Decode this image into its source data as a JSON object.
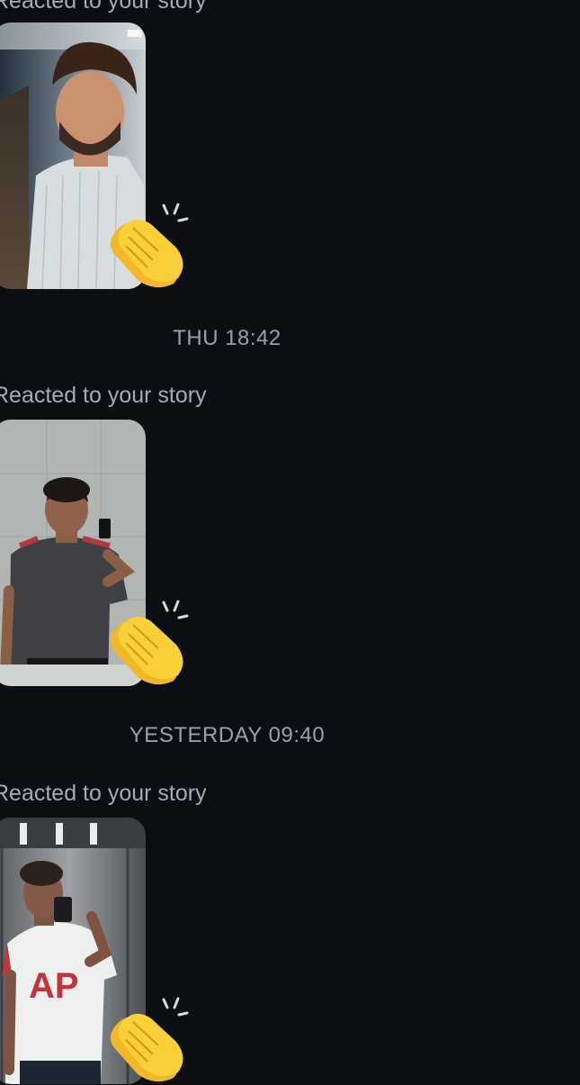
{
  "thread": {
    "messages": [
      {
        "label": "Reacted to your story",
        "reaction": "clapping-hands-emoji",
        "story": "story-thumbnail-corridor"
      },
      {
        "timestamp": "THU 18:42",
        "label": "Reacted to your story",
        "reaction": "clapping-hands-emoji",
        "story": "story-thumbnail-mirror-selfie"
      },
      {
        "timestamp": "YESTERDAY 09:40",
        "label": "Reacted to your story",
        "reaction": "clapping-hands-emoji",
        "story": "story-thumbnail-elevator-selfie"
      }
    ]
  },
  "colors": {
    "background": "#0b0f14",
    "secondary_text": "#a6abb3",
    "timestamp_text": "#9ba0a8",
    "clap_yellow": "#f7c22b"
  }
}
